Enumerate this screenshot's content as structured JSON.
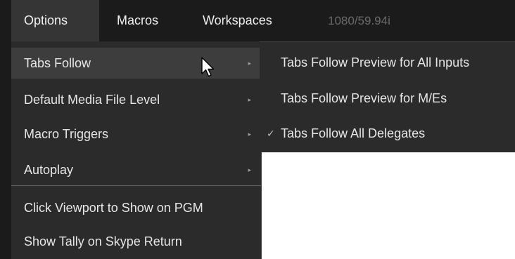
{
  "menubar": {
    "items": [
      {
        "label": "Options"
      },
      {
        "label": "Macros"
      },
      {
        "label": "Workspaces"
      }
    ],
    "status": "1080/59.94i"
  },
  "options_menu": {
    "items": [
      {
        "label": "Tabs Follow",
        "submenu_arrow": "▸"
      },
      {
        "label": "Default Media File Level",
        "submenu_arrow": "▸"
      },
      {
        "label": "Macro Triggers",
        "submenu_arrow": "▸"
      },
      {
        "label": "Autoplay",
        "submenu_arrow": "▸"
      },
      {
        "label": "Click Viewport to Show on PGM"
      },
      {
        "label": "Show Tally on Skype Return"
      }
    ]
  },
  "tabs_follow_submenu": {
    "items": [
      {
        "label": "Tabs Follow Preview for All Inputs",
        "checked": false
      },
      {
        "label": "Tabs Follow Preview for M/Es",
        "checked": false
      },
      {
        "label": "Tabs Follow All Delegates",
        "checked": true,
        "check_glyph": "✓"
      }
    ]
  },
  "icons": {
    "cursor": "mouse-pointer-icon",
    "submenu_arrow": "chevron-right-icon",
    "check": "checkmark-icon"
  },
  "colors": {
    "menubar_bg": "#1b1b1b",
    "menu_bg": "#2b2b2b",
    "highlight_bg": "#3d3d3d",
    "text": "#e6e6e6",
    "status_text": "#6a6a6a"
  }
}
